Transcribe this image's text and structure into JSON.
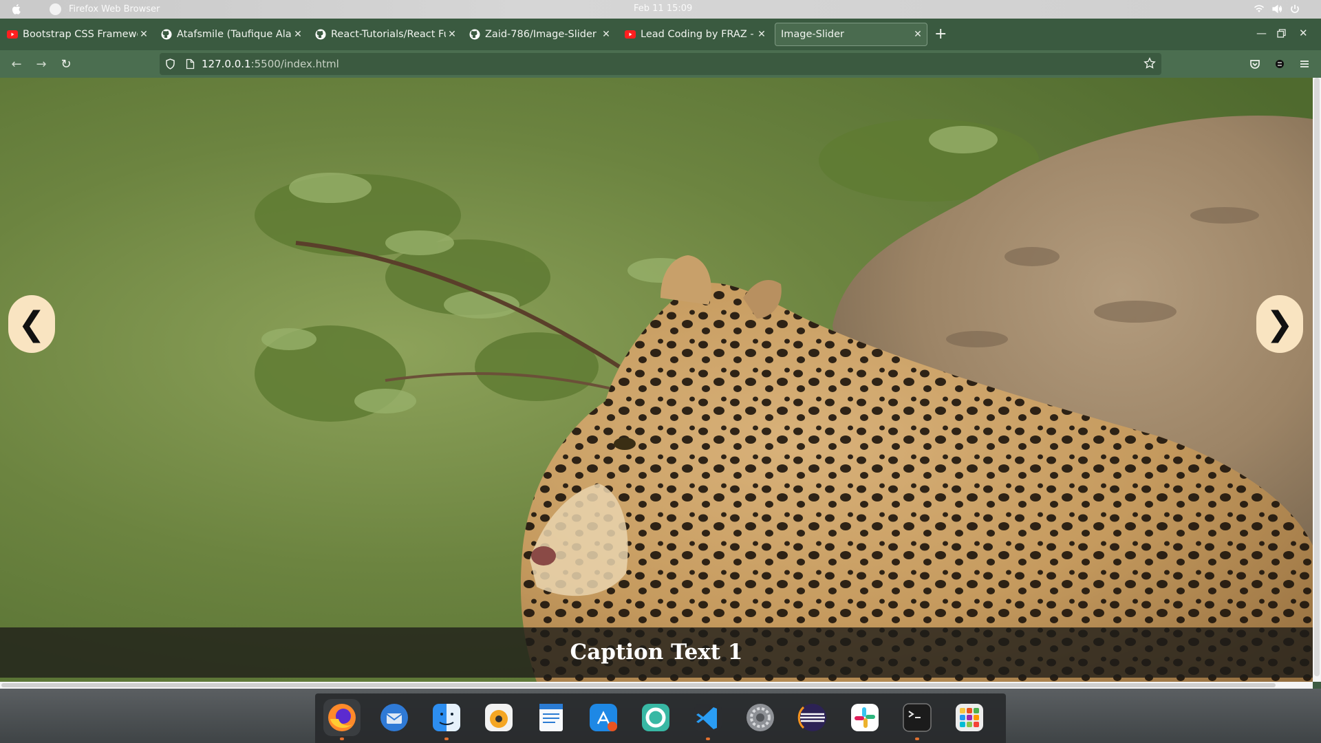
{
  "system_bar": {
    "app_name": "Firefox Web Browser",
    "clock": "Feb 11  15:09"
  },
  "tabs": [
    {
      "label": "Bootstrap CSS Framewor",
      "icon": "youtube-icon"
    },
    {
      "label": "Atafsmile (Taufique Alam",
      "icon": "github-icon"
    },
    {
      "label": "React-Tutorials/React Fun",
      "icon": "github-icon"
    },
    {
      "label": "Zaid-786/Image-Slider",
      "icon": "github-icon"
    },
    {
      "label": "Lead Coding by FRAZ - Yo",
      "icon": "youtube-icon"
    },
    {
      "label": "Image-Slider",
      "icon": "none",
      "active": true
    }
  ],
  "address_bar": {
    "host": "127.0.0.1",
    "path": ":5500/index.html"
  },
  "slider": {
    "prev_label": "❮",
    "next_label": "❯",
    "caption": "Caption Text 1"
  },
  "colors": {
    "browser_theme": "#3e5b42",
    "arrow_bg": "#f9e4c1",
    "caption_bg": "#1e1c18",
    "accent_indicator": "#e2702f"
  },
  "dock": {
    "items": [
      {
        "name": "firefox",
        "running": true
      },
      {
        "name": "thunderbird",
        "running": false
      },
      {
        "name": "finder",
        "running": true
      },
      {
        "name": "rhythmbox",
        "running": false
      },
      {
        "name": "libreoffice-writer",
        "running": false
      },
      {
        "name": "app-store",
        "running": false
      },
      {
        "name": "help",
        "running": false
      },
      {
        "name": "vscode",
        "running": true
      },
      {
        "name": "settings",
        "running": false
      },
      {
        "name": "eclipse",
        "running": false
      },
      {
        "name": "slack",
        "running": false
      },
      {
        "name": "terminal",
        "running": true
      },
      {
        "name": "app-grid",
        "running": false
      }
    ]
  }
}
